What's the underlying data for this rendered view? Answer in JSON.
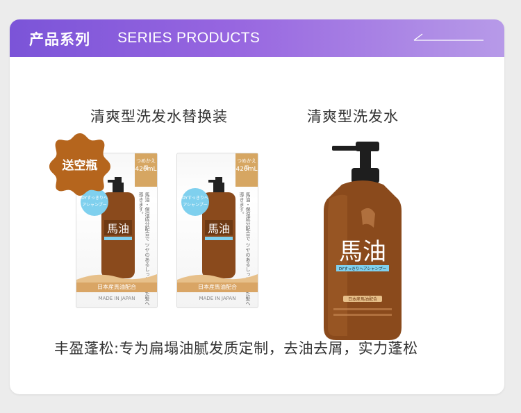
{
  "header": {
    "title_cn": "产品系列",
    "title_en": "SERIES PRODUCTS"
  },
  "products": [
    {
      "name": "清爽型洗发水替换装",
      "badge": "送空瓶",
      "pouch": {
        "top_label": "つめかえ用",
        "volume": "420mL",
        "bubble": "DYすっきりヘアシャンプー",
        "side_text": "馬油・保湿成分配合で ツヤのあるしっとりした髪へ導きます。",
        "brand": "馬油",
        "band": "日本産馬油配合",
        "origin": "MADE IN JAPAN"
      }
    },
    {
      "name": "清爽型洗发水",
      "bottle": {
        "brand": "馬油",
        "sub": "DYすっきりヘアシャンプー",
        "band": "日本産馬油配合"
      }
    }
  ],
  "footer_text": "丰盈蓬松:专为扁塌油腻发质定制，去油去屑，实力蓬松",
  "colors": {
    "header_start": "#7b54d8",
    "header_end": "#b79ae8",
    "badge": "#b5651d",
    "bottle_amber": "#8a4a1c",
    "band_gold": "#d9a565"
  }
}
